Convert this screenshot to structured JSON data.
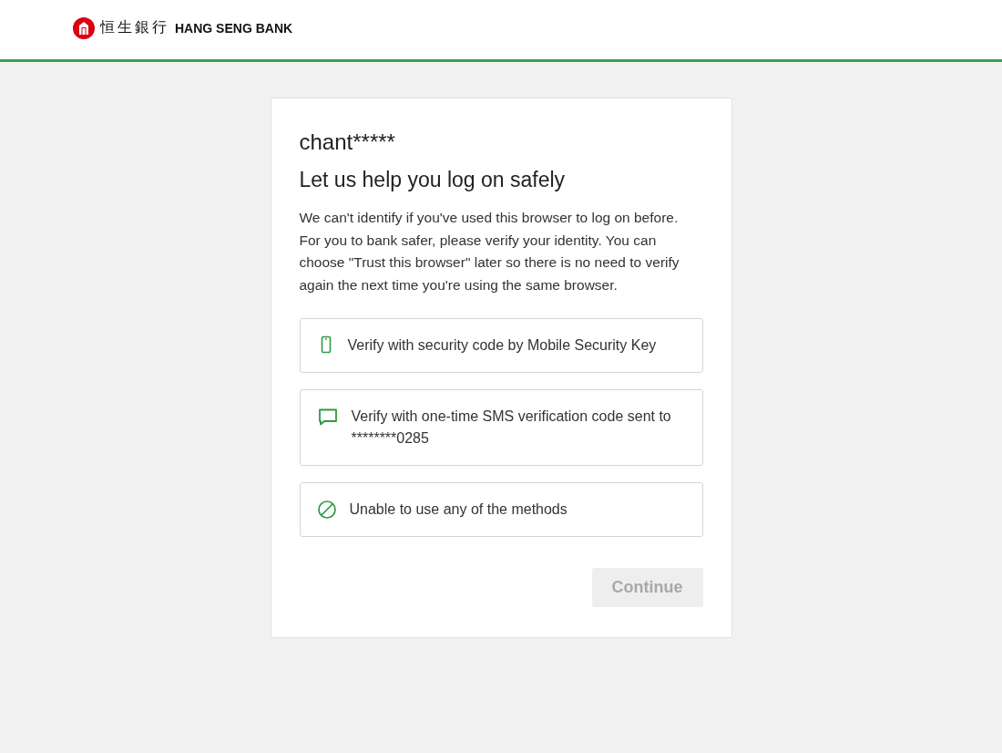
{
  "header": {
    "logo_chinese": "恒生銀行",
    "logo_english": "HANG SENG BANK"
  },
  "card": {
    "username": "chant*****",
    "heading": "Let us help you log on safely",
    "message": "We can't identify if you've used this browser to log on before. For you to bank safer, please verify your identity. You can choose \"Trust this browser\" later so there is no need to verify again the next time you're using the same browser.",
    "options": [
      {
        "kind": "mobile",
        "label": "Verify with security code by Mobile Security Key",
        "selected": false
      },
      {
        "kind": "sms",
        "label": "Verify with one-time SMS verification code sent to ********0285",
        "selected": false
      },
      {
        "kind": "unable",
        "label": "Unable to use any of the methods",
        "selected": false
      }
    ],
    "continue_button": {
      "label": "Continue",
      "disabled": true
    }
  }
}
